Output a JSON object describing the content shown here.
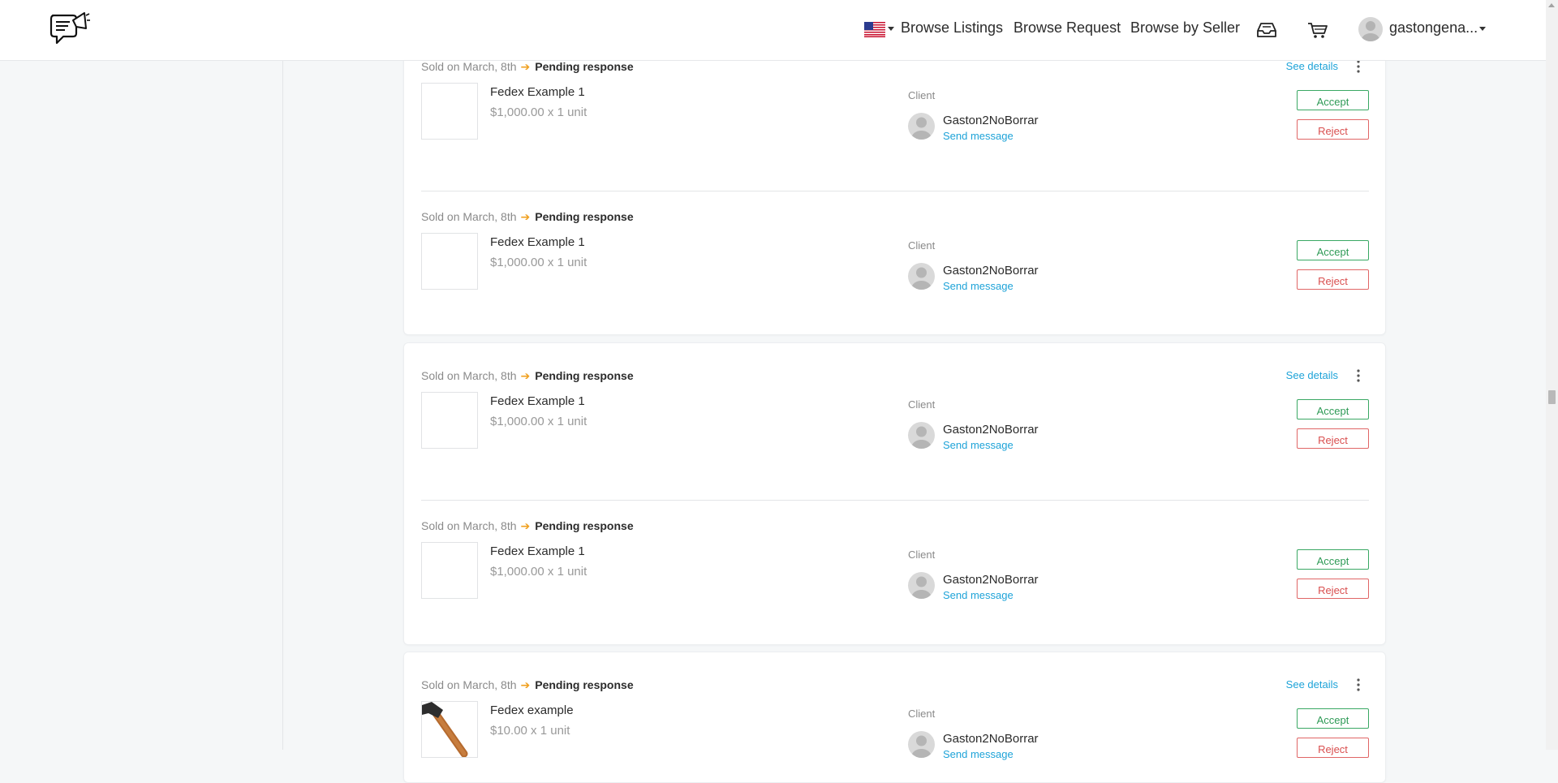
{
  "header": {
    "nav": {
      "browse_listings": "Browse Listings",
      "browse_request": "Browse Request",
      "browse_by_seller": "Browse by Seller"
    },
    "user_name": "gastongena..."
  },
  "orders": [
    {
      "sold_label": "Sold on March, 8th",
      "status": "Pending response",
      "see_details": "See details",
      "product_name": "Fedex Example 1",
      "price": "$1,000.00 x 1 unit",
      "client_label": "Client",
      "client_name": "Gaston2NoBorrar",
      "send_message": "Send message",
      "accept": "Accept",
      "reject": "Reject"
    },
    {
      "sold_label": "Sold on March, 8th",
      "status": "Pending response",
      "product_name": "Fedex Example 1",
      "price": "$1,000.00 x 1 unit",
      "client_label": "Client",
      "client_name": "Gaston2NoBorrar",
      "send_message": "Send message",
      "accept": "Accept",
      "reject": "Reject"
    },
    {
      "sold_label": "Sold on March, 8th",
      "status": "Pending response",
      "see_details": "See details",
      "product_name": "Fedex Example 1",
      "price": "$1,000.00 x 1 unit",
      "client_label": "Client",
      "client_name": "Gaston2NoBorrar",
      "send_message": "Send message",
      "accept": "Accept",
      "reject": "Reject"
    },
    {
      "sold_label": "Sold on March, 8th",
      "status": "Pending response",
      "product_name": "Fedex Example 1",
      "price": "$1,000.00 x 1 unit",
      "client_label": "Client",
      "client_name": "Gaston2NoBorrar",
      "send_message": "Send message",
      "accept": "Accept",
      "reject": "Reject"
    },
    {
      "sold_label": "Sold on March, 8th",
      "status": "Pending response",
      "see_details": "See details",
      "product_name": "Fedex example",
      "price": "$10.00 x 1 unit",
      "client_label": "Client",
      "client_name": "Gaston2NoBorrar",
      "send_message": "Send message",
      "accept": "Accept",
      "reject": "Reject"
    }
  ],
  "icons": {
    "logo": "chat-megaphone-logo",
    "flag": "us-flag-icon",
    "inbox": "inbox-icon",
    "cart": "cart-icon",
    "more": "more-vertical-icon"
  },
  "colors": {
    "accent": "#1ea3d8",
    "accept": "#2e9a56",
    "reject": "#d94f4f",
    "status_arrow": "#f0a020"
  }
}
